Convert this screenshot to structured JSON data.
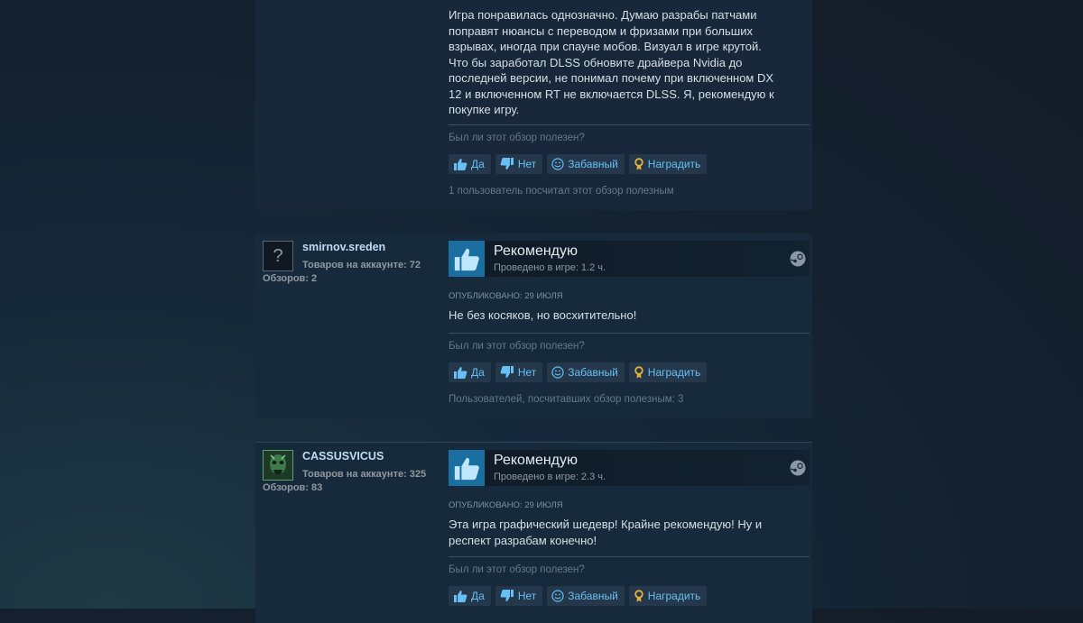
{
  "colors": {
    "link": "#66c0f4",
    "thumb_box": "#1a6fa0",
    "award": "#e2b43b"
  },
  "buttons": {
    "yes": "Да",
    "no": "Нет",
    "funny": "Забавный",
    "award": "Наградить"
  },
  "review_question": "Был ли этот обзор полезен?",
  "reviews": [
    {
      "content": "Игра понравилась однозначно. Думаю разрабы патчами поправят нюансы с переводом и фризами при больших взрывах, иногда при спауне мобов. Визуал в игре крутой. Что бы заработал DLSS обновите драйвера Nvidia до последней версии, не понимал почему при включенном DX 12 и включенном RT не включается DLSS. Я, рекомендую к покупке игру.",
      "helpful": "1 пользователь посчитал этот обзор полезным"
    },
    {
      "username": "smirnov.sreden",
      "avatar_icon": "?",
      "products_owned": "Товаров на аккаунте: 72",
      "reviews_count": "Обзоров: 2",
      "verdict": "Рекомендую",
      "hours": "Проведено в игре: 1.2 ч.",
      "posted": "Опубликовано: 29 июля",
      "content": "Не без косяков, но восхитительно!",
      "helpful": "Пользователей, посчитавших обзор полезным: 3"
    },
    {
      "username": "CASSUSVICUS",
      "products_owned": "Товаров на аккаунте: 325",
      "reviews_count": "Обзоров: 83",
      "verdict": "Рекомендую",
      "hours": "Проведено в игре: 2.3 ч.",
      "posted": "Опубликовано: 29 июля",
      "content": "Эта игра графический шедевр! Крайне рекомендую! Ну и респект разрабам конечно!"
    }
  ]
}
